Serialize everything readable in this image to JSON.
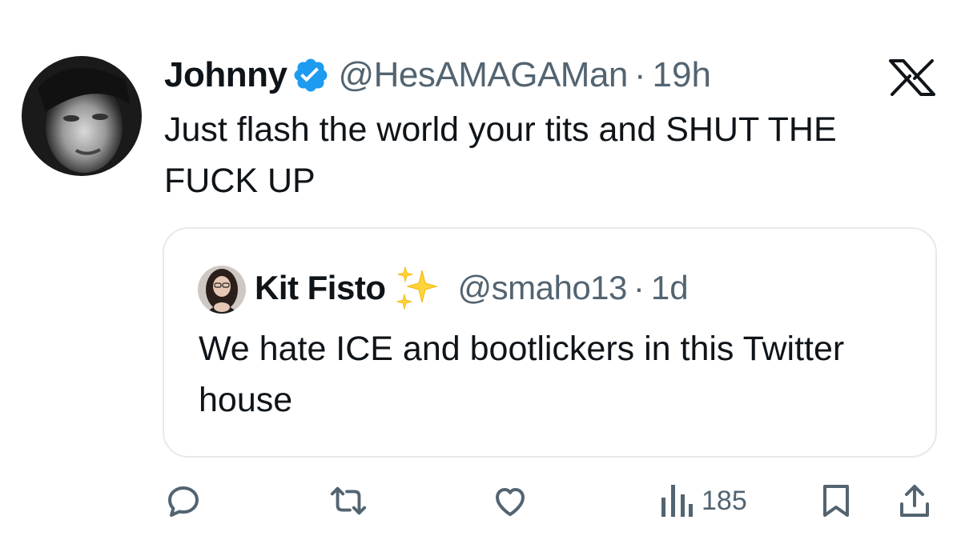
{
  "author": {
    "display_name": "Johnny",
    "handle": "@HesAMAGAMan",
    "separator": "·",
    "time": "19h",
    "verified_icon": "verified-badge-icon",
    "verified_color": "#1d9bf0"
  },
  "tweet": {
    "text": "Just flash the world your tits and SHUT THE FUCK UP"
  },
  "quote": {
    "display_name": "Kit Fisto",
    "emoji_icon": "sparkles-icon",
    "handle": "@smaho13",
    "separator": "·",
    "time": "1d",
    "text": "We hate ICE and bootlickers in this Twitter house"
  },
  "actions": {
    "views": "185",
    "icons": [
      "reply-icon",
      "retweet-icon",
      "like-icon",
      "views-icon",
      "bookmark-icon",
      "share-icon"
    ]
  },
  "platform": {
    "logo_icon": "x-logo-icon"
  },
  "colors": {
    "text_primary": "#0f1419",
    "text_secondary": "#536471",
    "border": "#e6e9ec",
    "icon": "#536471"
  }
}
